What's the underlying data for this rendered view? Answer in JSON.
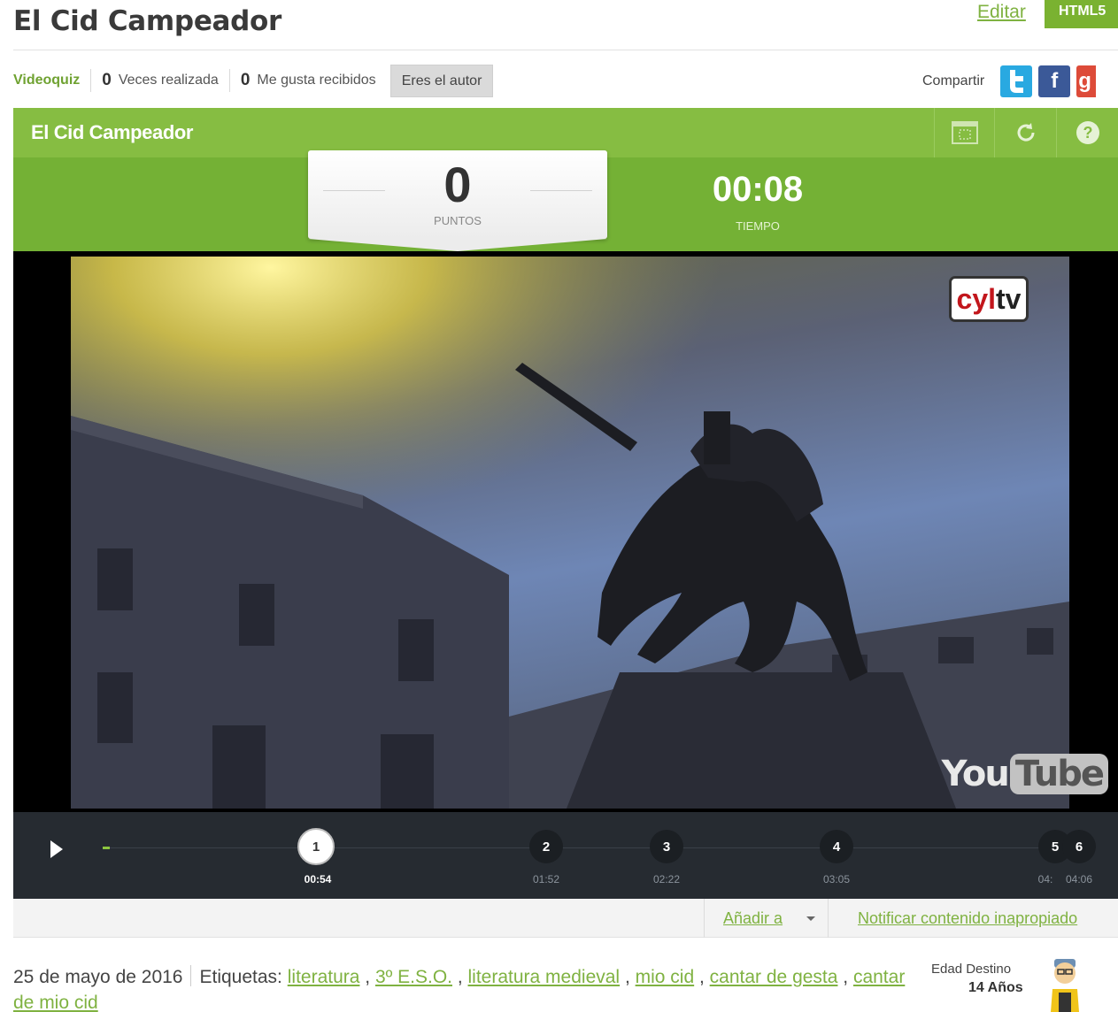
{
  "header": {
    "title": "El Cid Campeador",
    "edit_label": "Editar",
    "badge": "HTML5"
  },
  "meta": {
    "type": "Videoquiz",
    "plays_count": "0",
    "plays_label": "Veces realizada",
    "likes_count": "0",
    "likes_label": "Me gusta recibidos",
    "author_button": "Eres el autor",
    "share_label": "Compartir",
    "share_icons": [
      "twitter-icon",
      "facebook-icon",
      "google-plus-icon"
    ]
  },
  "quiz": {
    "title": "El Cid Campeador",
    "score": "0",
    "score_label": "PUNTOS",
    "time": "00:08",
    "time_label": "TIEMPO",
    "tools": [
      "fullscreen-icon",
      "restart-icon",
      "help-icon"
    ]
  },
  "video": {
    "channel_logo": "cyltv",
    "player_logo": "YouTube"
  },
  "timeline": {
    "progress": 0.0,
    "markers": [
      {
        "num": "1",
        "time": "00:54",
        "active": true
      },
      {
        "num": "2",
        "time": "01:52"
      },
      {
        "num": "3",
        "time": "02:22"
      },
      {
        "num": "4",
        "time": "03:05"
      },
      {
        "num": "5",
        "time": "04:"
      },
      {
        "num": "6",
        "time": "04:06"
      }
    ]
  },
  "actions": {
    "add_to": "Añadir a",
    "report": "Notificar contenido inapropiado"
  },
  "footer": {
    "date": "25 de mayo de 2016",
    "tags_label": "Etiquetas:",
    "tags": [
      "literatura",
      "3º E.S.O.",
      "literatura medieval",
      "mio cid",
      "cantar de gesta",
      "cantar de mio cid"
    ],
    "age_label": "Edad Destino",
    "age_value": "14 Años"
  },
  "colors": {
    "brand_green": "#86bd42",
    "link_green": "#7fb241",
    "timeline_bg": "#262b31"
  }
}
